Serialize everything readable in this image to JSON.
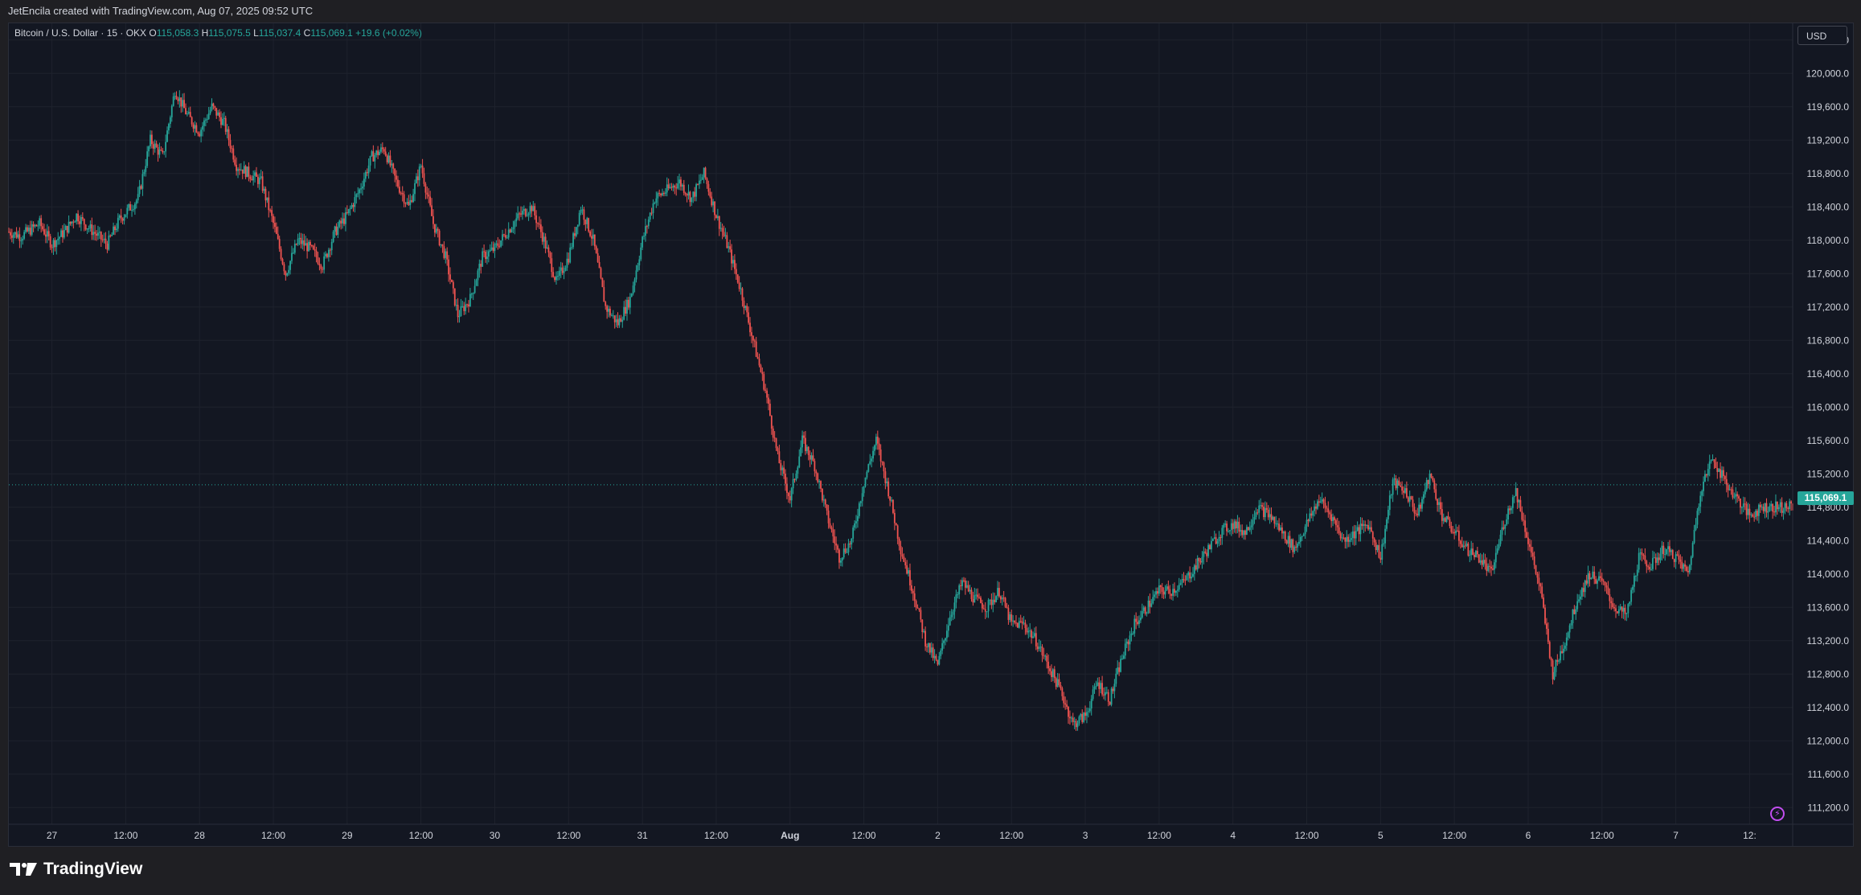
{
  "header": {
    "attribution": "JetEncila created with TradingView.com, Aug 07, 2025 09:52 UTC"
  },
  "legend": {
    "symbol": "Bitcoin / U.S. Dollar · 15 · OKX",
    "open_key": "O",
    "open": "115,058.3",
    "high_key": "H",
    "high": "115,075.5",
    "low_key": "L",
    "low": "115,037.4",
    "close_key": "C",
    "close": "115,069.1",
    "change": "+19.6 (+0.02%)"
  },
  "currency_button": "USD",
  "last_price_tag": "115,069.1",
  "footer": {
    "brand": "TradingView"
  },
  "colors": {
    "background": "#131722",
    "grid": "#1e222d",
    "up": "#26a69a",
    "down": "#ef5350",
    "axis_text": "#d1d4dc",
    "accent": "#c24ef0"
  },
  "icons": {
    "alert": "lightning-bolt-icon",
    "brand": "tradingview-logo-icon"
  },
  "chart_data": {
    "type": "candlestick",
    "title": "",
    "xlabel": "",
    "ylabel": "",
    "grid": true,
    "ylim": [
      111000,
      120600
    ],
    "y_ticks": [
      "120,400.0",
      "120,000.0",
      "119,600.0",
      "119,200.0",
      "118,800.0",
      "118,400.0",
      "118,000.0",
      "117,600.0",
      "117,200.0",
      "116,800.0",
      "116,400.0",
      "116,000.0",
      "115,600.0",
      "115,200.0",
      "114,800.0",
      "114,400.0",
      "114,000.0",
      "113,600.0",
      "113,200.0",
      "112,800.0",
      "112,400.0",
      "112,000.0",
      "111,600.0",
      "111,200.0"
    ],
    "y_tick_values": [
      120400,
      120000,
      119600,
      119200,
      118800,
      118400,
      118000,
      117600,
      117200,
      116800,
      116400,
      116000,
      115600,
      115200,
      114800,
      114400,
      114000,
      113600,
      113200,
      112800,
      112400,
      112000,
      111600,
      111200
    ],
    "x_ticks": [
      "27",
      "12:00",
      "28",
      "12:00",
      "29",
      "12:00",
      "30",
      "12:00",
      "31",
      "12:00",
      "Aug",
      "12:00",
      "2",
      "12:00",
      "3",
      "12:00",
      "4",
      "12:00",
      "5",
      "12:00",
      "6",
      "12:00",
      "7",
      "12:"
    ],
    "x_tick_hours": [
      12,
      24,
      36,
      48,
      60,
      72,
      84,
      96,
      108,
      120,
      132,
      144,
      156,
      168,
      180,
      192,
      204,
      216,
      228,
      240,
      252,
      264,
      276,
      288
    ],
    "x_range_hours": [
      5,
      295
    ],
    "last_close": 115069.1,
    "path_hours": [
      5,
      7,
      10,
      12,
      14,
      16,
      18,
      21,
      23,
      26,
      28,
      30,
      32,
      34,
      36,
      38,
      40,
      42,
      44,
      46,
      48,
      50,
      52,
      54,
      56,
      58,
      60,
      62,
      64,
      66,
      68,
      70,
      72,
      74,
      76,
      78,
      80,
      82,
      84,
      86,
      88,
      90,
      92,
      94,
      96,
      98,
      100,
      102,
      104,
      106,
      108,
      110,
      112,
      114,
      116,
      118,
      120,
      122,
      124,
      126,
      128,
      130,
      132,
      134,
      136,
      138,
      140,
      142,
      144,
      146,
      148,
      150,
      152,
      154,
      156,
      158,
      160,
      162,
      164,
      166,
      168,
      170,
      172,
      174,
      176,
      178,
      180,
      182,
      184,
      186,
      188,
      190,
      192,
      194,
      196,
      198,
      200,
      202,
      204,
      206,
      208,
      210,
      212,
      214,
      216,
      218,
      220,
      222,
      224,
      226,
      228,
      230,
      232,
      234,
      236,
      238,
      240,
      242,
      244,
      246,
      248,
      250,
      252,
      254,
      256,
      258,
      260,
      262,
      264,
      266,
      268,
      270,
      272,
      274,
      276,
      278,
      280,
      282,
      284,
      286,
      288,
      290
    ],
    "path_close": [
      118100,
      118050,
      118200,
      117950,
      118100,
      118300,
      118150,
      117950,
      118250,
      118500,
      119200,
      119000,
      119800,
      119500,
      119300,
      119600,
      119400,
      118900,
      118800,
      118700,
      118200,
      117600,
      118000,
      117900,
      117700,
      118100,
      118300,
      118600,
      119000,
      119100,
      118700,
      118400,
      118900,
      118200,
      117800,
      117100,
      117300,
      117800,
      117900,
      118100,
      118300,
      118400,
      118000,
      117500,
      117800,
      118400,
      118000,
      117200,
      117000,
      117300,
      118000,
      118500,
      118600,
      118700,
      118500,
      118800,
      118300,
      117900,
      117400,
      116800,
      116200,
      115400,
      114900,
      115600,
      115300,
      114700,
      114200,
      114400,
      115100,
      115600,
      115000,
      114300,
      113800,
      113200,
      112900,
      113500,
      113900,
      113700,
      113600,
      113800,
      113400,
      113400,
      113200,
      112900,
      112600,
      112200,
      112300,
      112700,
      112500,
      113000,
      113400,
      113600,
      113800,
      113800,
      113900,
      114100,
      114300,
      114500,
      114600,
      114500,
      114800,
      114700,
      114500,
      114300,
      114600,
      114900,
      114700,
      114400,
      114500,
      114600,
      114200,
      115100,
      115000,
      114700,
      115200,
      114700,
      114500,
      114300,
      114200,
      114000,
      114600,
      115000,
      114400,
      113800,
      112800,
      113200,
      113700,
      114000,
      113900,
      113600,
      113500,
      114200,
      114100,
      114300,
      114200,
      114000,
      115000,
      115400,
      115100,
      114900,
      114700,
      114800,
      114500,
      114300,
      114700,
      114900,
      115069.1
    ]
  }
}
